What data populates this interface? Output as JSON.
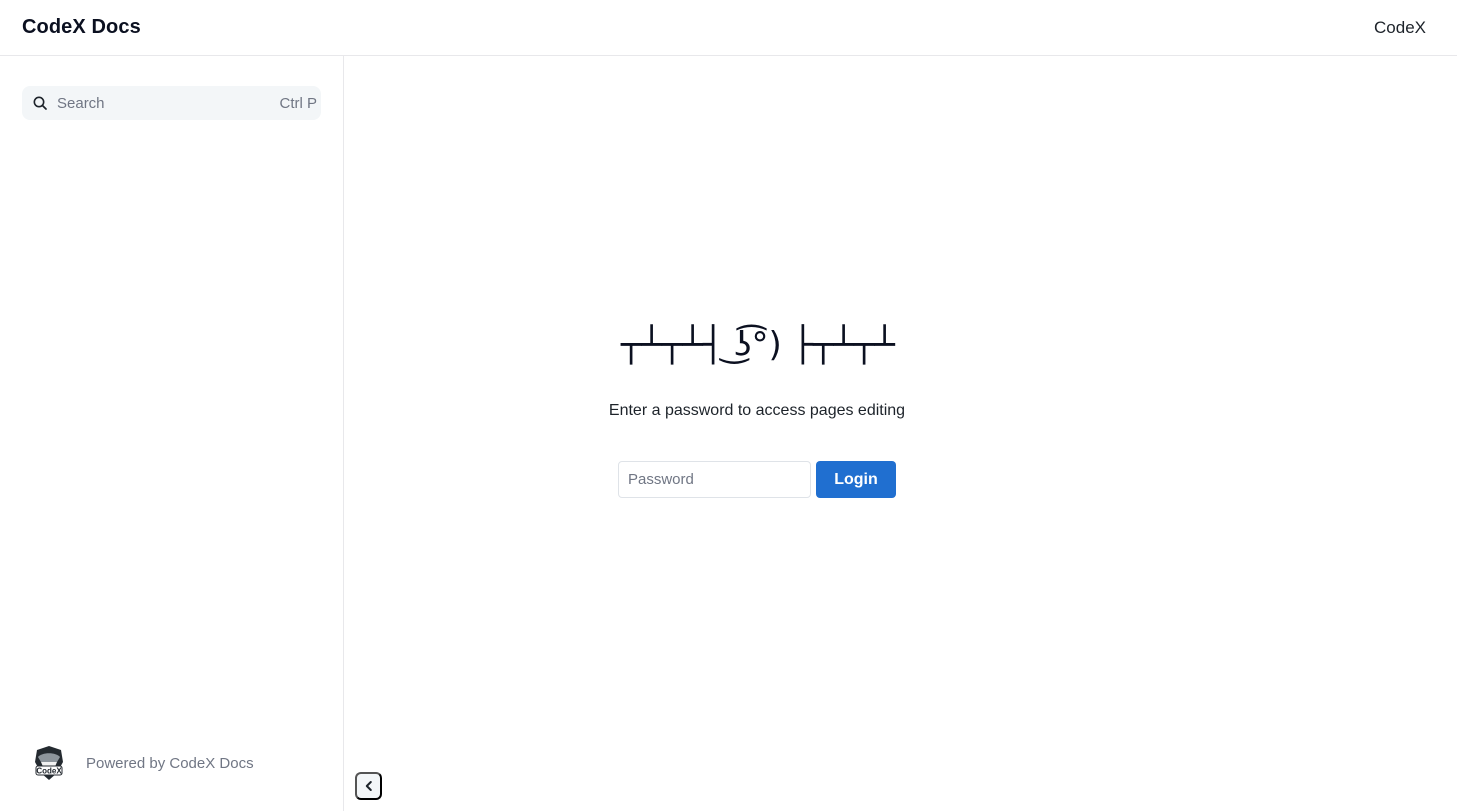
{
  "header": {
    "brand": "CodeX Docs",
    "link": "CodeX"
  },
  "sidebar": {
    "search": {
      "placeholder": "Search",
      "shortcut": "Ctrl P",
      "icon": "search-icon"
    },
    "footer": {
      "logo_text": "CodeX",
      "powered_by": "Powered by CodeX Docs"
    },
    "collapse_icon": "chevron-left-icon"
  },
  "main": {
    "emoticon": "┬┴┬┴┤ ͜ʖ͡°) ├┬┴┬┴",
    "message": "Enter a password to access pages editing",
    "password_placeholder": "Password",
    "login_label": "Login"
  },
  "colors": {
    "accent": "#206fd0",
    "border": "#e8e8eb",
    "muted_text": "#707684",
    "search_bg": "#f3f6f8"
  }
}
